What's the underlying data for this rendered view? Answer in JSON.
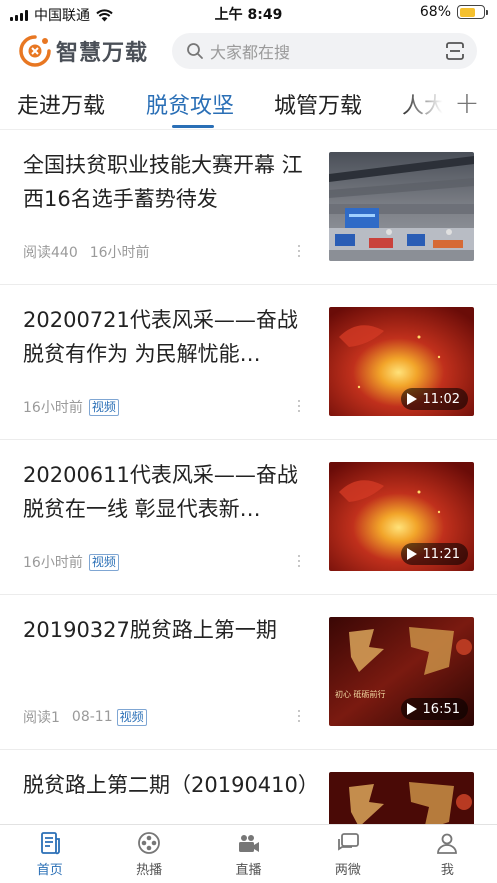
{
  "status_bar": {
    "carrier": "中国联通",
    "time": "上午 8:49",
    "battery": "68%",
    "battery_level": 0.68
  },
  "header": {
    "app_name": "智慧万载",
    "search_placeholder": "大家都在搜"
  },
  "tabs": [
    {
      "label": "走进万载",
      "active": false
    },
    {
      "label": "脱贫攻坚",
      "active": true
    },
    {
      "label": "城管万载",
      "active": false
    },
    {
      "label": "人大",
      "active": false
    }
  ],
  "articles": [
    {
      "title": "全国扶贫职业技能大赛开幕 江西16名选手蓄势待发",
      "meta": [
        "阅读440",
        "16小时前"
      ],
      "tag": "",
      "duration": ""
    },
    {
      "title": "20200721代表风采——奋战脱贫有作为 为民解忧能…",
      "meta": [
        "16小时前"
      ],
      "tag": "视频",
      "duration": "11:02"
    },
    {
      "title": "20200611代表风采——奋战脱贫在一线 彰显代表新…",
      "meta": [
        "16小时前"
      ],
      "tag": "视频",
      "duration": "11:21"
    },
    {
      "title": "20190327脱贫路上第一期",
      "meta": [
        "阅读1",
        "08-11"
      ],
      "tag": "视频",
      "duration": "16:51",
      "thumb_caption": "初心 砥砺前行"
    },
    {
      "title": "脱贫路上第二期（20190410）",
      "meta": [],
      "tag": "",
      "duration": ""
    }
  ],
  "bottom_nav": [
    {
      "label": "首页",
      "icon": "home-news-icon",
      "active": true
    },
    {
      "label": "热播",
      "icon": "film-reel-icon",
      "active": false
    },
    {
      "label": "直播",
      "icon": "video-camera-icon",
      "active": false
    },
    {
      "label": "两微",
      "icon": "chat-bubbles-icon",
      "active": false
    },
    {
      "label": "我",
      "icon": "user-icon",
      "active": false
    }
  ],
  "colors": {
    "accent": "#2a6fb6",
    "logo_orange": "#e87722"
  }
}
